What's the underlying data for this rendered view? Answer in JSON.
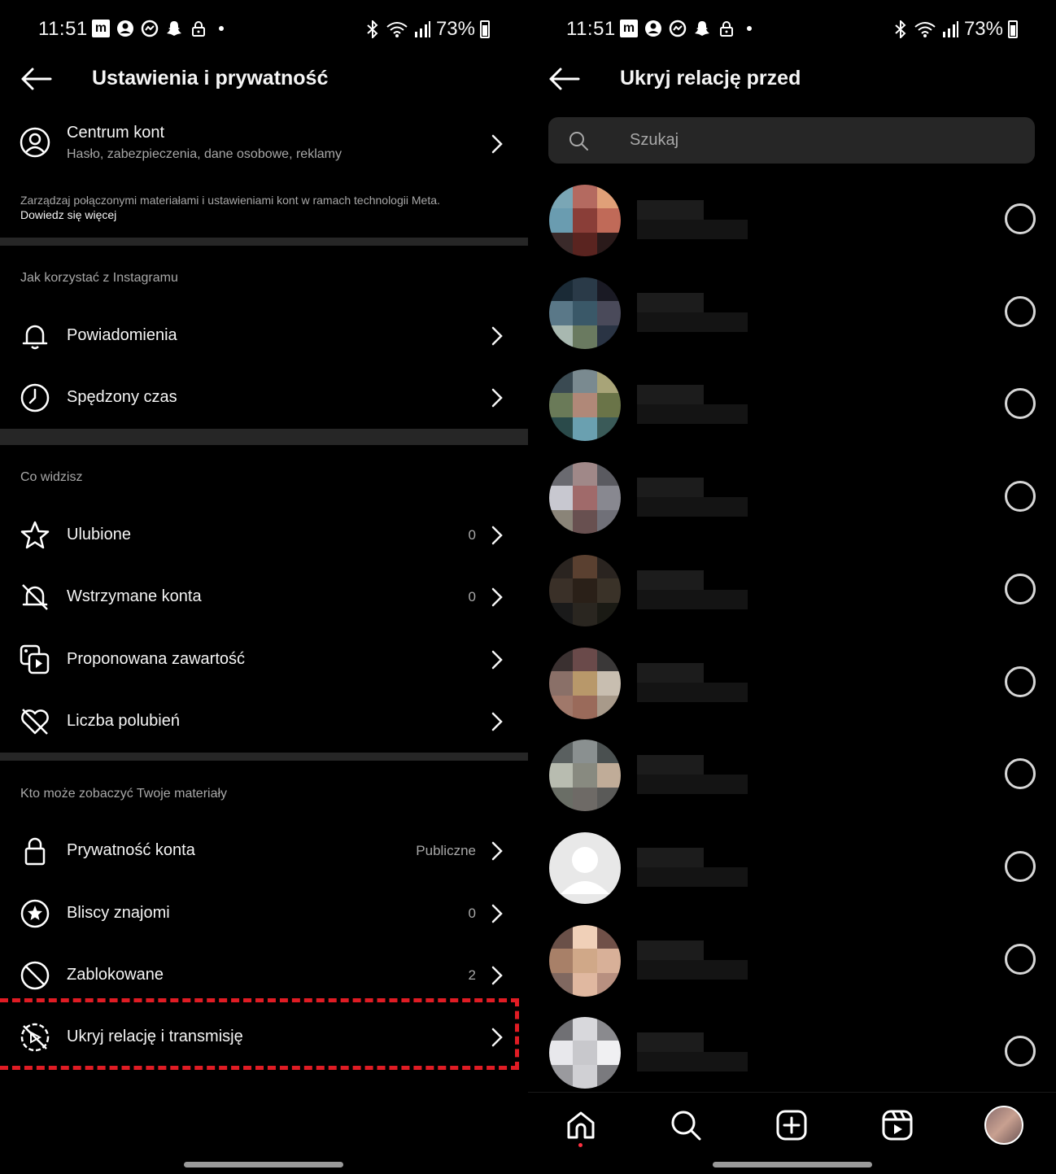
{
  "status_bar": {
    "time": "11:51",
    "battery": "73%"
  },
  "left": {
    "header_title": "Ustawienia i prywatność",
    "account_center": {
      "title": "Centrum kont",
      "subtitle": "Hasło, zabezpieczenia, dane osobowe, reklamy"
    },
    "meta_note": "Zarządzaj połączonymi materiałami i ustawieniami kont w ramach technologii Meta.",
    "meta_link": "Dowiedz się więcej",
    "sections": [
      {
        "heading": "Jak korzystać z Instagramu"
      },
      {
        "heading": "Co widzisz"
      },
      {
        "heading": "Kto może zobaczyć Twoje materiały"
      }
    ],
    "items": [
      {
        "label": "Powiadomienia",
        "value": ""
      },
      {
        "label": "Spędzony czas",
        "value": ""
      },
      {
        "label": "Ulubione",
        "value": "0"
      },
      {
        "label": "Wstrzymane konta",
        "value": "0"
      },
      {
        "label": "Proponowana zawartość",
        "value": ""
      },
      {
        "label": "Liczba polubień",
        "value": ""
      },
      {
        "label": "Prywatność konta",
        "value": "Publiczne"
      },
      {
        "label": "Bliscy znajomi",
        "value": "0"
      },
      {
        "label": "Zablokowane",
        "value": "2"
      },
      {
        "label": "Ukryj relację i transmisję",
        "value": ""
      }
    ],
    "highlight_color": "#e01c24"
  },
  "right": {
    "header_title": "Ukryj relację przed",
    "search_placeholder": "Szukaj",
    "users": [
      {
        "colors": [
          "#7aa6b5",
          "#b46a60",
          "#e0a078",
          "#6a9cb0",
          "#8a3e38",
          "#c06a58",
          "#3a2a2a",
          "#5a2420",
          "#2a1a1a"
        ]
      },
      {
        "colors": [
          "#1a2a36",
          "#2a3a48",
          "#1a1a24",
          "#5a7888",
          "#3a5868",
          "#4a4a5a",
          "#a8b8b0",
          "#6a7a60",
          "#2a3444"
        ]
      },
      {
        "colors": [
          "#3a4a52",
          "#7a8a90",
          "#a8a478",
          "#6a7a58",
          "#b08878",
          "#6a7448",
          "#2a4a4a",
          "#6aa0b0",
          "#3a5a58"
        ]
      },
      {
        "colors": [
          "#6a6a70",
          "#a08888",
          "#5a5a60",
          "#c8c8d0",
          "#a06a6a",
          "#888890",
          "#8a8478",
          "#685050",
          "#707078"
        ]
      },
      {
        "colors": [
          "#2a2420",
          "#5a4030",
          "#2a2420",
          "#3a3028",
          "#2a2018",
          "#3a3228",
          "#1a1a1a",
          "#2a2620",
          "#1a1a14"
        ]
      },
      {
        "colors": [
          "#3a3030",
          "#6a4a4a",
          "#3a3838",
          "#8a7068",
          "#b8986a",
          "#c8beb0",
          "#a0786a",
          "#9a6a5a",
          "#a89a8a"
        ]
      },
      {
        "colors": [
          "#5a6060",
          "#8a9090",
          "#4a5050",
          "#b8bcb0",
          "#888a80",
          "#c0ac98",
          "#6a6e66",
          "#6e6a66",
          "#5a5a58"
        ]
      },
      {
        "default": true
      },
      {
        "colors": [
          "#6a5048",
          "#f0d0b8",
          "#705048",
          "#a88068",
          "#d0a888",
          "#d8b098",
          "#806860",
          "#e0b8a0",
          "#b89080"
        ]
      },
      {
        "colors": [
          "#707074",
          "#d8d8dc",
          "#8a8a8e",
          "#e8e8ec",
          "#c8c8cc",
          "#f0f0f2",
          "#9a9a9e",
          "#d0d0d4",
          "#7a7a7e"
        ]
      }
    ]
  }
}
